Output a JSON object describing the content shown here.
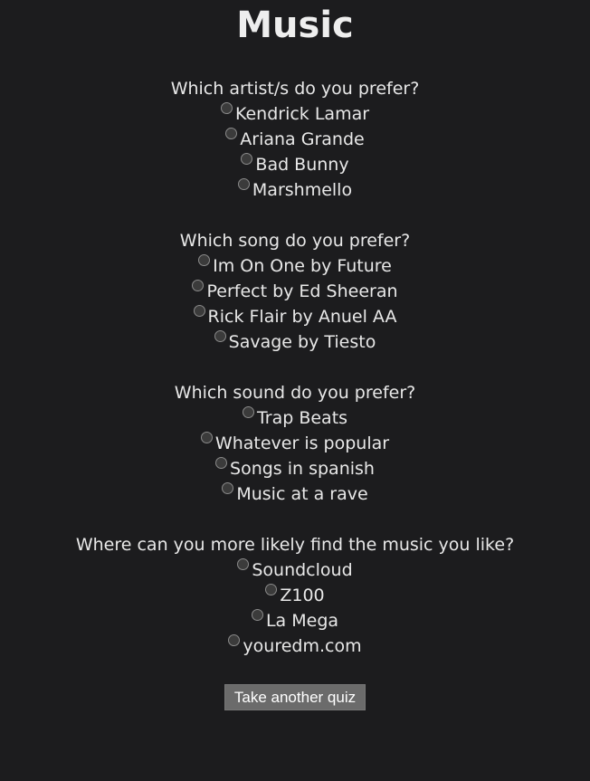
{
  "page": {
    "title": "Music"
  },
  "questions": [
    {
      "text": "Which artist/s do you prefer?",
      "options": [
        "Kendrick Lamar",
        "Ariana Grande",
        "Bad Bunny",
        "Marshmello"
      ]
    },
    {
      "text": "Which song do you prefer?",
      "options": [
        "Im On One by Future",
        "Perfect by Ed Sheeran",
        "Rick Flair by Anuel AA",
        "Savage by Tiesto"
      ]
    },
    {
      "text": "Which sound do you prefer?",
      "options": [
        "Trap Beats",
        "Whatever is popular",
        "Songs in spanish",
        "Music at a rave"
      ]
    },
    {
      "text": "Where can you more likely find the music you like?",
      "options": [
        "Soundcloud",
        "Z100",
        "La Mega",
        "youredm.com"
      ]
    }
  ],
  "actions": {
    "retake_label": "Take another quiz"
  },
  "colors": {
    "background": "#1c1c1e",
    "text": "#e8e8e8",
    "button_bg": "#6b6b6b"
  }
}
